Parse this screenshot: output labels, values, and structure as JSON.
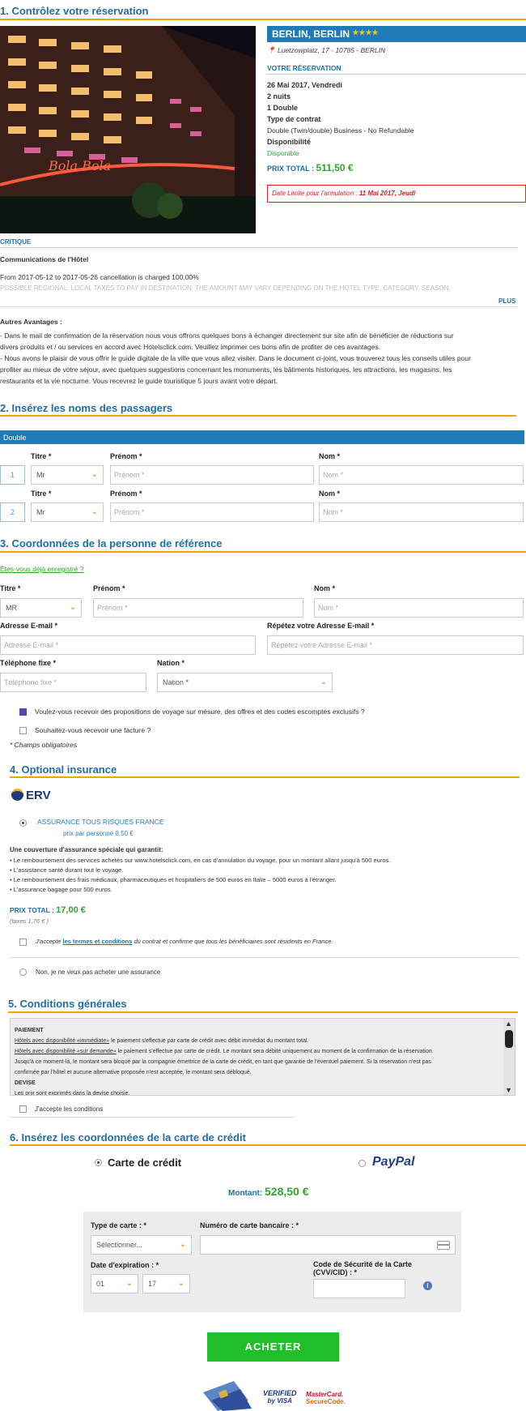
{
  "section1": {
    "title": "1. Contrôlez votre réservation",
    "hotel_name": "BERLIN, BERLIN",
    "stars": "★★★★",
    "address": "Luetzowplatz, 17 - 10785 - BERLIN",
    "reservation_title": "VOTRE RÉSERVATION",
    "date": "26 Mai 2017, Vendredi",
    "nights": "2 nuits",
    "rooms": "1 Double",
    "contract_label": "Type de contrat",
    "contract_value": "Double (Twin/double) Business - No Refundable",
    "availability_label": "Disponibilité",
    "availability_value": "Disponible",
    "total_label": "PRIX TOTAL :",
    "total_value": "511,50 €",
    "cancel_prefix": "Date Limite pour l'annulation :",
    "cancel_date": "11 Mai 2017, Jeudi",
    "critique": "CRITIQUE",
    "comm_title": "Communications de l'Hôtel",
    "comm_text": "From 2017-05-12 to 2017-05-26 cancellation is charged 100.00%",
    "comm_faded": "POSSIBLE REGIONAL, LOCAL TAXES TO PAY IN DESTINATION. THE AMOUNT MAY VARY DEPENDING ON THE HOTEL TYPE, CATEGORY, SEASON.",
    "plus": "PLUS",
    "advantages_title": "Autres Avantages :",
    "adv1_l1": "- Dans le mail de confirmation de la réservation nous vous offrons quelques bons à échanger directement sur site afin de bénéficier de réductions sur",
    "adv1_l2": "divers produits et / ou services en accord avec Hotelsclick.com. Veuillez imprimer ces bons afin de profiter de ces avantages.",
    "adv2_l1": "- Nous avons le plaisir de vous offrir le guide digitale de la ville que vous allez visiter. Dans le document ci-joint, vous trouverez tous les conseils utiles pour",
    "adv2_l2": "profiter au mieux de votre séjour, avec quelques suggestions concernant les monuments, les bâtiments historiques, les attractions, les magasins, les",
    "adv2_l3": "restaurants et la vie nocturne. Vous recevrez le guide touristique 5 jours avant votre départ."
  },
  "section2": {
    "title": "2. Insérez les noms des passagers",
    "room_bar": "Double",
    "titre_label": "Titre *",
    "prenom_label": "Prénom *",
    "nom_label": "Nom *",
    "rows": [
      {
        "num": "1",
        "titre": "Mr",
        "prenom_ph": "Prénom *",
        "nom_ph": "Nom *"
      },
      {
        "num": "2",
        "titre": "Mr",
        "prenom_ph": "Prénom *",
        "nom_ph": "Nom *"
      }
    ]
  },
  "section3": {
    "title": "3. Coordonnées de la personne de référence",
    "registered_link": "Êtes-vous déjà enregistré ?",
    "titre_label": "Titre *",
    "titre_value": "MR",
    "prenom_label": "Prénom *",
    "prenom_ph": "Prénom *",
    "nom_label": "Nom *",
    "nom_ph": "Nom *",
    "email_label": "Adresse E-mail *",
    "email_ph": "Adresse E-mail *",
    "email2_label": "Répétez votre Adresse E-mail  *",
    "email2_ph": "Répétez votre Adresse E-mail *",
    "tel_label": "Téléphone fixe *",
    "tel_ph": "Téléphone fixe *",
    "nation_label": "Nation *",
    "nation_value": "Nation *",
    "opt_offers": "Voulez-vous recevoir des propositions de voyage sur mésure, des offres et des codes escomptes exclusifs ?",
    "opt_invoice": "Souhaitez-vous recevoir une facture ?",
    "required_note": "* Champs obligatoires"
  },
  "section4": {
    "title": "4. Optional insurance",
    "logo": "ERV",
    "option_name": "ASSURANCE TOUS RISQUES FRANCE",
    "option_price": "prix par personne 8,50 €",
    "coverage_title": "Une couverture d'assurance spéciale qui garantit:",
    "bullets": [
      "• Le remboursement des services achetés sur www.hotelsclick.com, en cas d'annulation du voyage, pour un montant allant jusqu'à 500 euros.",
      "• L'assistance santé durant tout le voyage.",
      "• Le remboursement des frais médicaux, pharmaceutiques et hospitaliers de 500 euros en Italie – 5000 euros à l'étranger.",
      "• L'assurance bagage pour 500 euros."
    ],
    "total_label": "PRIX TOTAL :",
    "total_value": "17,00 €",
    "taxes": "(taxes 1,76 € )",
    "accept_prefix": "J'accepte",
    "accept_link": "les termes et conditions",
    "accept_suffix": "du contrat et confirme que tous les bénéficiaires sont résidents en France.",
    "decline": "Non, je ne veux pas acheter une assurance"
  },
  "section5": {
    "title": "5. Conditions générales",
    "h_payment": "PAIEMENT",
    "p1_link": "Hôtels avec disponibilité «immédiate»",
    "p1_text": " le paiement s'effectue par carte de crédit avec débit immédiat du montant total.",
    "p2_link": "Hôtels avec disponibilité «sur demande»",
    "p2_text": " le paiement s'effectue par carte de crédit. Le montant sera débité uniquement au moment de la confirmation de la réservation.",
    "p3": "Jusqu'à ce moment-là, le montant sera bloqué par la compagnie émettrice de la carte de crédit, en tant que garantie de l'éventuel paiement. Si la réservation n'est pas",
    "p4": "confirmée par l'hôtel et aucune alternative proposée n'est acceptée, le montant sera débloqué.",
    "h_currency": "DEVISE",
    "p5": "Les prix sont exprimés dans la devise choisie.",
    "accept": "J'accepte les conditions"
  },
  "section6": {
    "title": "6. Insérez les coordonnées de la carte de crédit",
    "credit_card": "Carte de crédit",
    "paypal": "PayPal",
    "amount_label": "Montant:",
    "amount_value": "528,50 €",
    "card_type_label": "Type de carte : *",
    "card_type_value": "Sélectionner...",
    "card_number_label": "Numéro de carte bancaire : *",
    "expiry_label": "Date d'expiration : *",
    "expiry_month": "01",
    "expiry_year": "17",
    "cvv_label_1": "Code de Sécurité de la Carte",
    "cvv_label_2": "(CVV/CID) : *",
    "buy_button": "ACHETER",
    "verified_1": "VERIFIED",
    "verified_2": "by VISA",
    "mc_1": "MasterCard.",
    "mc_2": "SecureCode."
  },
  "colors": {
    "section_title": "#1f6fa5",
    "accent_line": "#f0a500",
    "price_green": "#2fa52f",
    "buy_button": "#1fbf2a"
  }
}
